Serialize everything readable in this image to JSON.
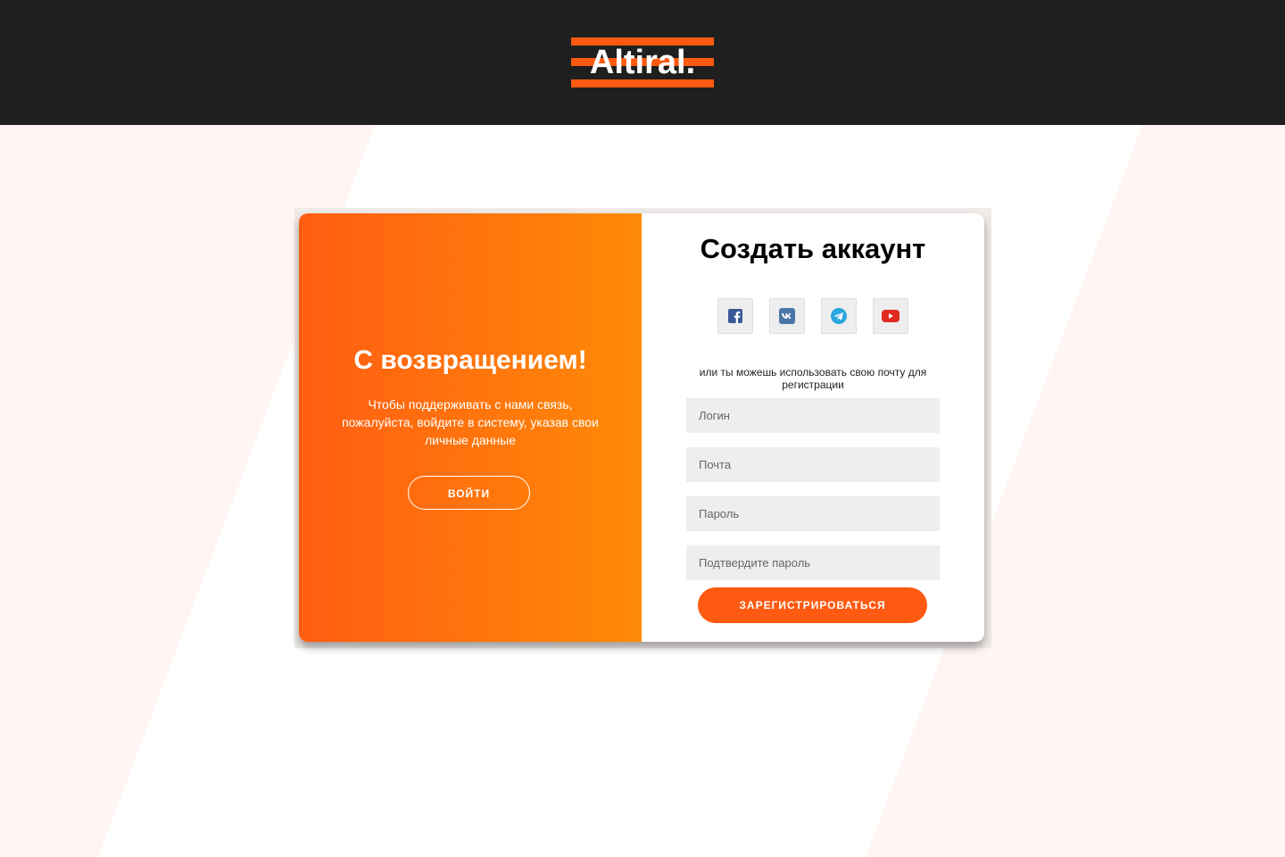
{
  "brand": {
    "logo_text": "Altiral."
  },
  "colors": {
    "header_bg": "#1f1f1f",
    "accent": "#ff5a12",
    "gradient_start": "#ff5d12",
    "gradient_end": "#ff8a07",
    "field_bg": "#eeeeee"
  },
  "welcome": {
    "title": "С возвращением!",
    "text": "Чтобы поддерживать с нами связь, пожалуйста, войдите в систему, указав свои личные данные",
    "login_label": "ВОЙТИ"
  },
  "register": {
    "title": "Создать аккаунт",
    "socials": [
      {
        "icon": "facebook-icon"
      },
      {
        "icon": "vk-icon"
      },
      {
        "icon": "telegram-icon"
      },
      {
        "icon": "youtube-icon"
      }
    ],
    "hint": "или ты можешь использовать свою почту для регистрации",
    "fields": {
      "login_placeholder": "Логин",
      "email_placeholder": "Почта",
      "password_placeholder": "Пароль",
      "confirm_placeholder": "Подтвердите пароль"
    },
    "submit_label": "ЗАРЕГИСТРИРОВАТЬСЯ"
  }
}
